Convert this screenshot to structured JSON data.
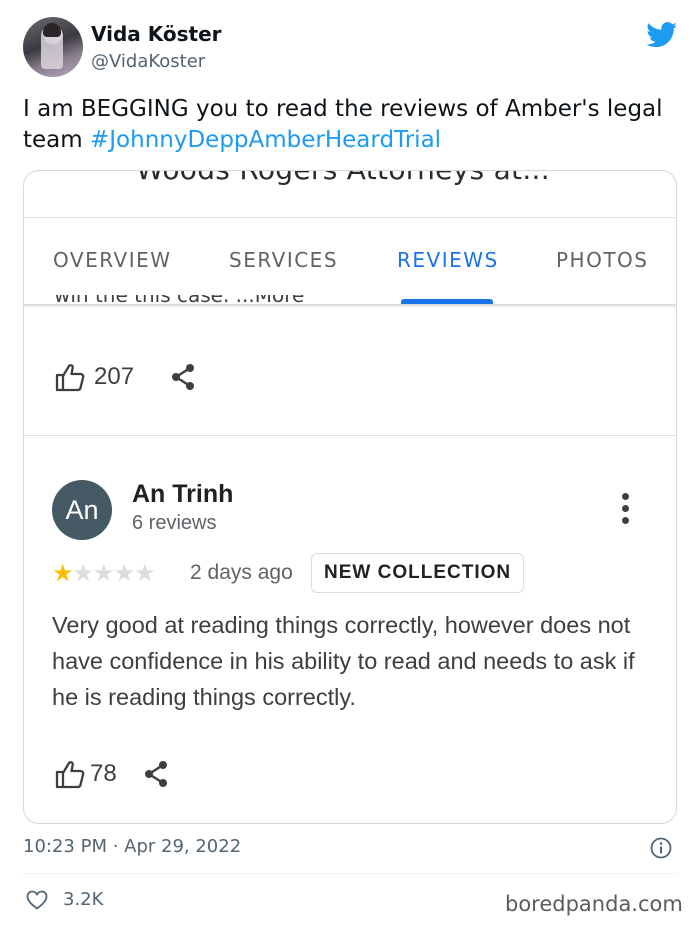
{
  "tweet": {
    "author_name": "Vida Köster",
    "author_handle": "@VidaKoster",
    "text": "I am BEGGING you to read the reviews of Amber's legal team ",
    "hashtag": "#JohnnyDeppAmberHeardTrial",
    "timestamp": "10:23 PM · Apr 29, 2022",
    "likes": "3.2K",
    "icons": [
      "twitter-bird-icon",
      "info-icon",
      "heart-icon"
    ]
  },
  "screenshot": {
    "title_cut": "Woods Rogers Attorneys at...",
    "tabs": [
      {
        "label": "OVERVIEW",
        "active": false
      },
      {
        "label": "SERVICES",
        "active": false
      },
      {
        "label": "REVIEWS",
        "active": true
      },
      {
        "label": "PHOTOS",
        "active": false
      }
    ],
    "cut_text": "win the this case. ...More",
    "prev_review": {
      "likes": "207"
    },
    "review": {
      "avatar_initials": "An",
      "author": "An Trinh",
      "review_count": "6 reviews",
      "rating": 1,
      "max_rating": 5,
      "date": "2 days ago",
      "badge": "NEW COLLECTION",
      "body": "Very good at reading things correctly, however does not have confidence in his ability to read and needs to ask if he is reading things correctly.",
      "likes": "78"
    },
    "accent_color": "#1a73e8",
    "star_color": "#fbbc04"
  },
  "watermark": "boredpanda.com"
}
